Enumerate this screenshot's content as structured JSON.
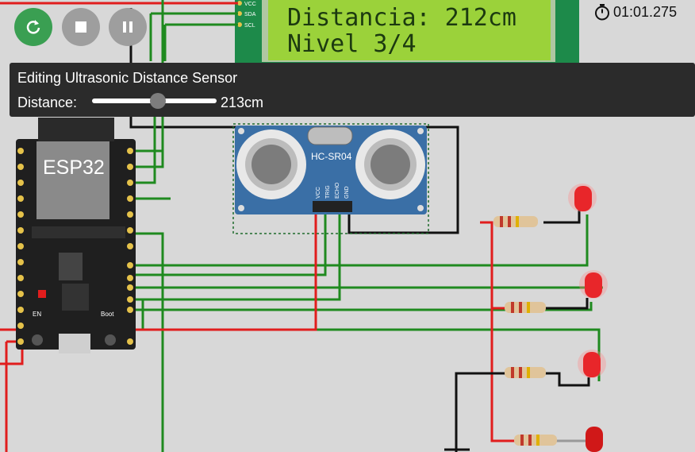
{
  "controls": {
    "restart_icon": "restart-icon",
    "stop_icon": "stop-icon",
    "pause_icon": "pause-icon"
  },
  "timer": {
    "value": "01:01.275",
    "icon": "stopwatch-icon"
  },
  "lcd": {
    "line1": "Distancia: 212cm",
    "line2": "Nivel 3/4",
    "pins": [
      "VCC",
      "SDA",
      "SCL"
    ]
  },
  "editor": {
    "title": "Editing Ultrasonic Distance Sensor",
    "distance_label": "Distance:",
    "distance_value": "213cm",
    "slider_fraction": 0.53
  },
  "esp32": {
    "label": "ESP32",
    "en_label": "EN",
    "boot_label": "Boot"
  },
  "sensor": {
    "model": "HC-SR04",
    "pins": [
      "VCC",
      "TRIG",
      "ECHO",
      "GND"
    ]
  },
  "colors": {
    "wire_red": "#e11d1d",
    "wire_green": "#1f8a1f",
    "wire_black": "#111111",
    "lcd_bg": "#9bd23a",
    "board_bg": "#1f1f1f",
    "sensor_bg": "#3a6fa6",
    "led_red": "#e8262a"
  }
}
